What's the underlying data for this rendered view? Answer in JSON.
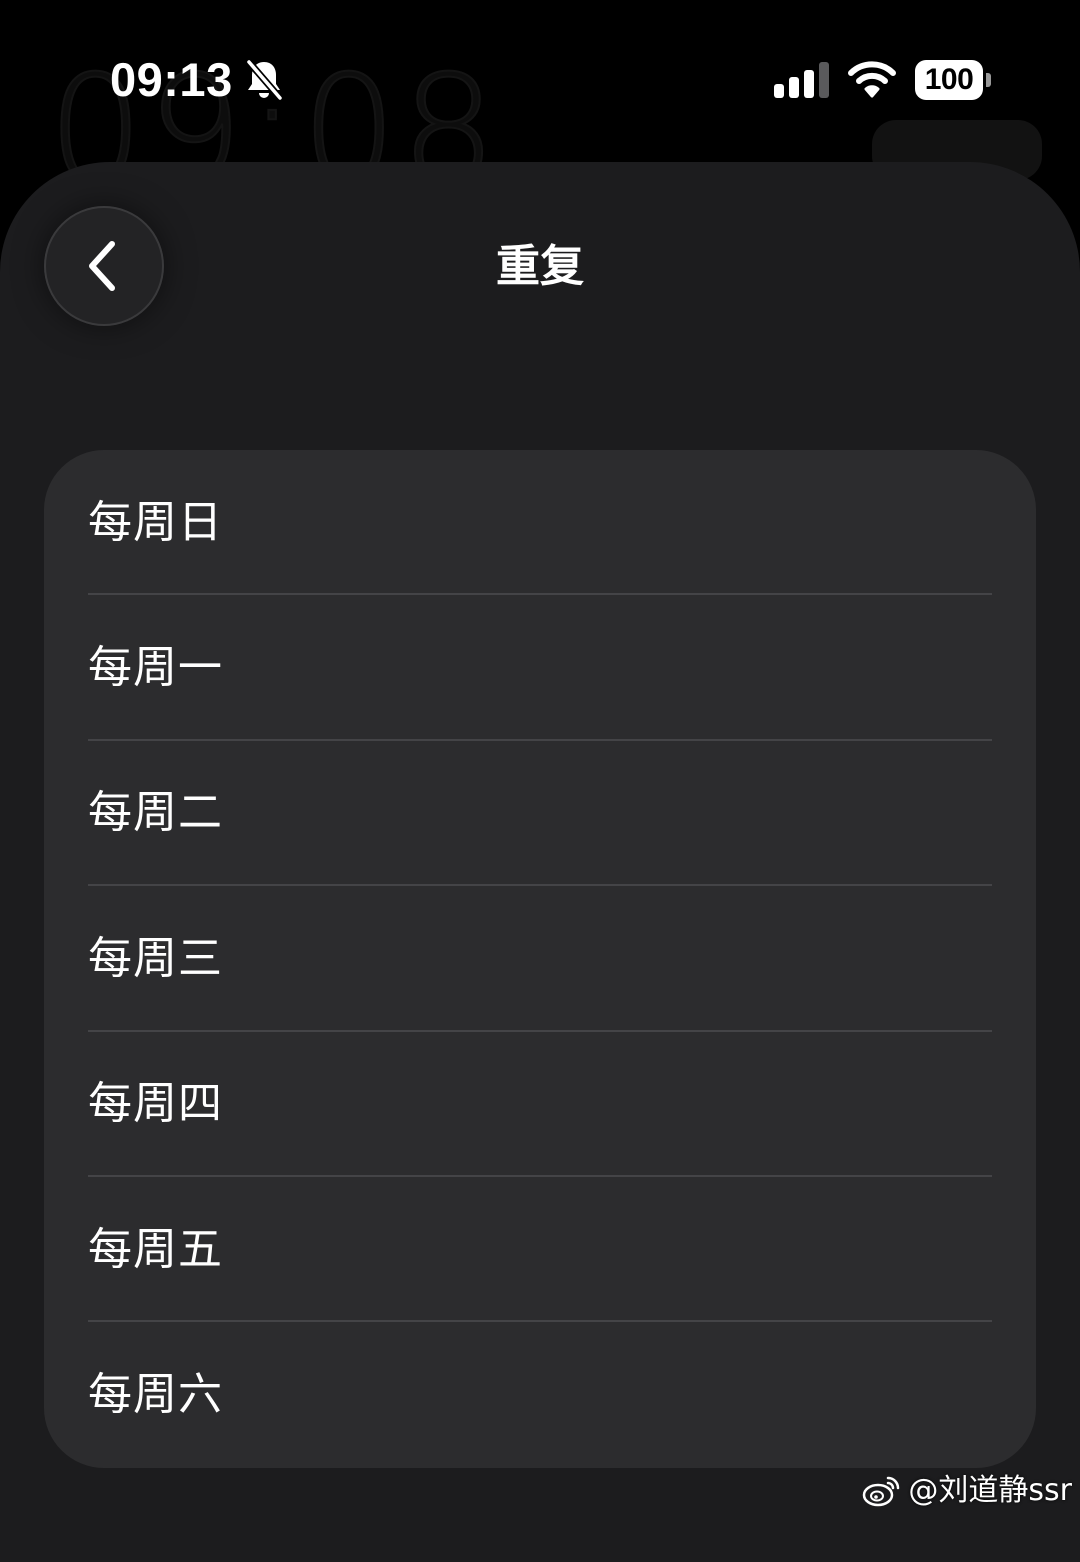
{
  "status_bar": {
    "time": "09:13",
    "background_clock": "09:08",
    "battery_level": "100",
    "icons": [
      "bell-slash-icon",
      "cellular-signal-icon",
      "wifi-icon",
      "battery-icon"
    ]
  },
  "header": {
    "back_icon": "chevron-left-icon",
    "title": "重复"
  },
  "repeat_options": [
    {
      "label": "每周日"
    },
    {
      "label": "每周一"
    },
    {
      "label": "每周二"
    },
    {
      "label": "每周三"
    },
    {
      "label": "每周四"
    },
    {
      "label": "每周五"
    },
    {
      "label": "每周六"
    }
  ],
  "watermark": {
    "icon": "weibo-icon",
    "text": "@刘道静ssr"
  },
  "colors": {
    "screen_background": "#000000",
    "sheet_background": "#1c1c1e",
    "list_background": "#2c2c2e",
    "divider": "#444447",
    "text": "#ffffff"
  }
}
